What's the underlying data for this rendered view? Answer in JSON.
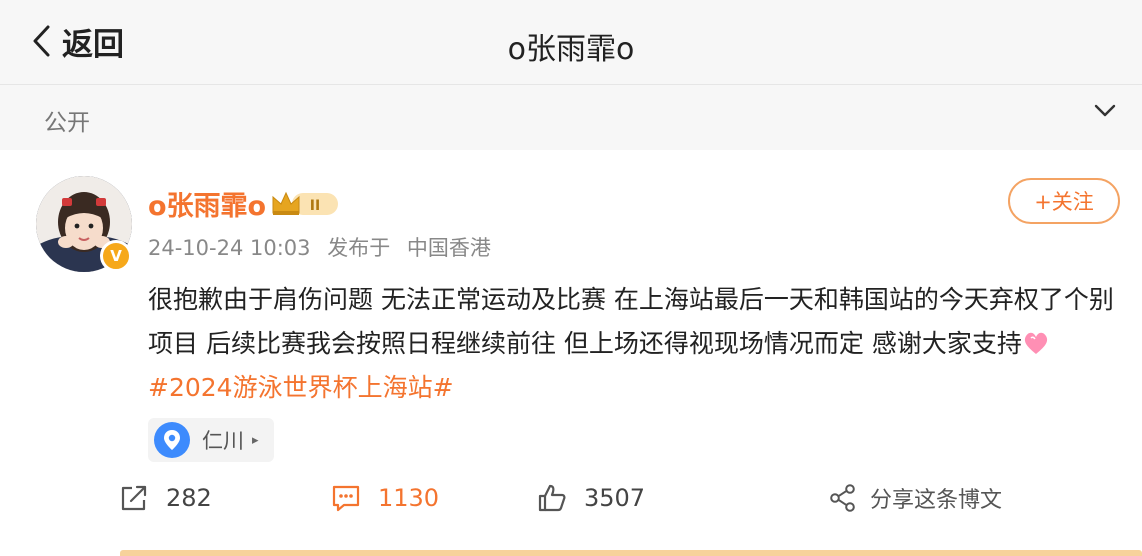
{
  "topbar": {
    "back_label": "返回",
    "title": "o张雨霏o"
  },
  "visibility": {
    "label": "公开"
  },
  "post": {
    "username": "o张雨霏o",
    "badge_level": "II",
    "timestamp": "24-10-24 10:03",
    "published_from": "发布于",
    "region": "中国香港",
    "follow_label": "+关注",
    "verified_mark": "V",
    "text_main": "很抱歉由于肩伤问题 无法正常运动及比赛 在上海站最后一天和韩国站的今天弃权了个别项目 后续比赛我会按照日程继续前往 但上场还得视现场情况而定 感谢大家支持",
    "hashtag": "#2024游泳世界杯上海站#",
    "location": "仁川",
    "location_caret": "▸"
  },
  "actions": {
    "repost_count": "282",
    "comment_count": "1130",
    "like_count": "3507",
    "share_label": "分享这条博文"
  },
  "colors": {
    "accent": "#f4742f",
    "background": "#f7f7f7",
    "card": "#ffffff",
    "badge_gold": "#f6a81a",
    "location_pin": "#3d8bfd"
  },
  "icons": {
    "back": "chevron-left-icon",
    "visibility_toggle": "chevron-down-icon",
    "crown": "crown-icon",
    "location": "location-pin-icon",
    "repost": "repost-icon",
    "comment": "comment-icon",
    "like": "thumbs-up-icon",
    "share": "share-icon",
    "heart": "heart-icon"
  }
}
